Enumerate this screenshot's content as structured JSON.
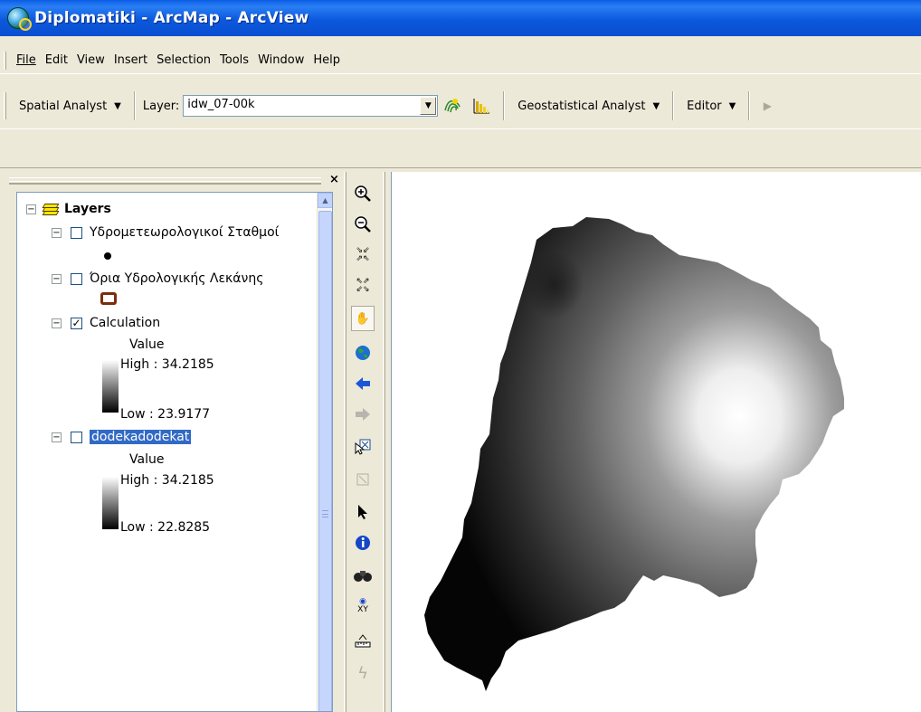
{
  "window": {
    "title": "Diplomatiki - ArcMap - ArcView"
  },
  "menu": [
    "File",
    "Edit",
    "View",
    "Insert",
    "Selection",
    "Tools",
    "Window",
    "Help"
  ],
  "toolbar": {
    "spatial_analyst": "Spatial Analyst",
    "layer_label": "Layer:",
    "layer_value": "idw_07-00k",
    "geostatistical_analyst": "Geostatistical Analyst",
    "editor": "Editor"
  },
  "toc": {
    "root": "Layers",
    "layers": [
      {
        "name": "Υδρομετεωρολογικοί Σταθμοί",
        "checked": false
      },
      {
        "name": "Όρια Υδρολογικής Λεκάνης",
        "checked": false
      },
      {
        "name": "Calculation",
        "checked": true,
        "legend_title": "Value",
        "high": "High : 34.2185",
        "low": "Low : 23.9177"
      },
      {
        "name": "dodekadodekat",
        "checked": false,
        "legend_title": "Value",
        "high": "High : 34.2185",
        "low": "Low : 22.8285"
      }
    ]
  },
  "colors": {
    "titlebar": "#0a5de4",
    "selection": "#316ac5",
    "boundary_swatch": "#7b2d0e"
  },
  "tools": [
    "zoom-in",
    "zoom-out",
    "fixed-zoom-in",
    "fixed-zoom-out",
    "pan",
    "full-extent",
    "back",
    "forward",
    "select-elements",
    "select-features",
    "pointer",
    "identify",
    "find",
    "go-to-xy",
    "measure",
    "hyperlink"
  ]
}
